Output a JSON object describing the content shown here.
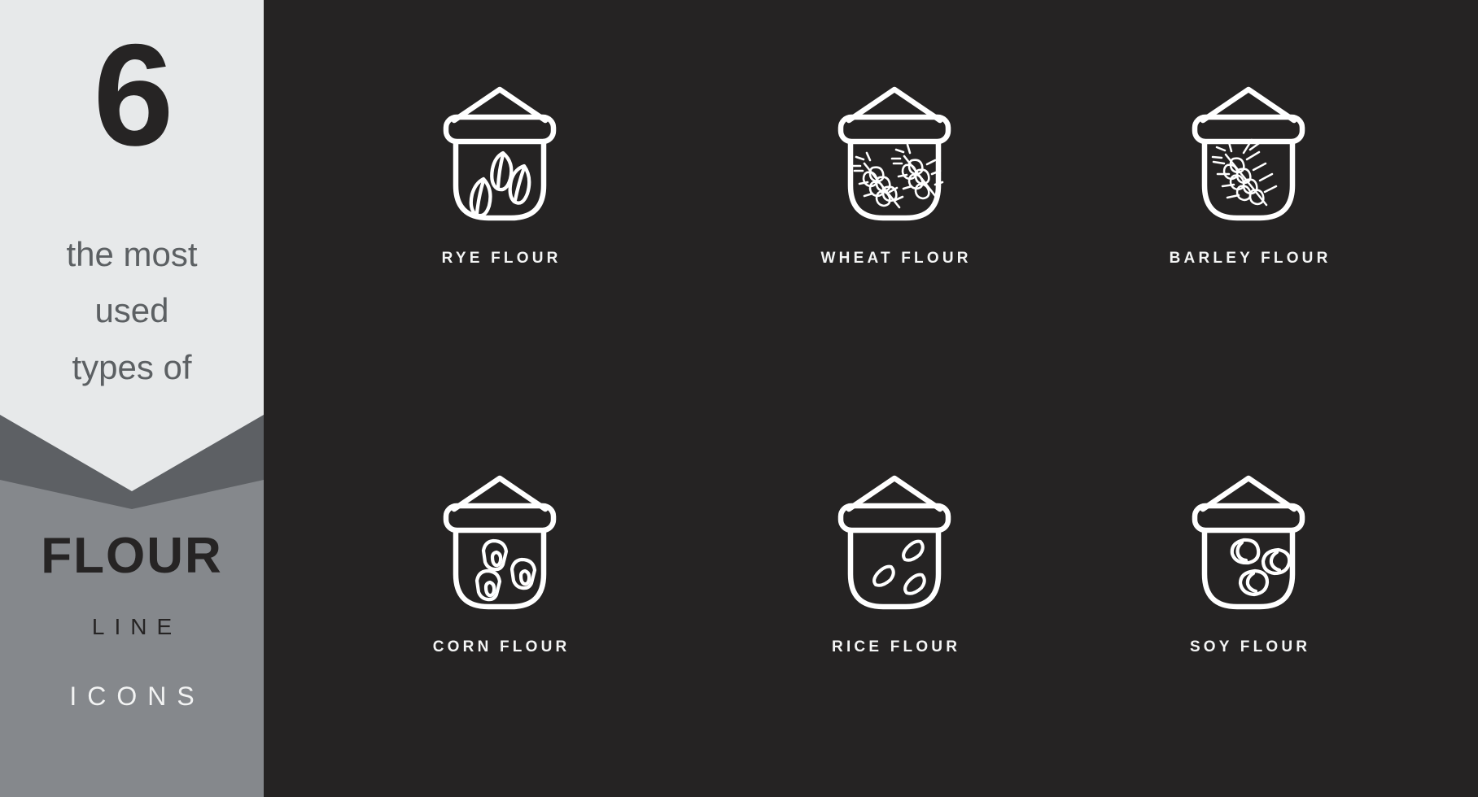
{
  "poster": {
    "background_color": "#252323",
    "panel_light_color": "#e7e9ea",
    "panel_mid_color": "#85888c",
    "panel_shadow_color": "#5d6064",
    "icon_stroke_color": "#ffffff",
    "label_color": "#f4f5f5"
  },
  "sidebar": {
    "count": "6",
    "subtitle_lines": [
      "the most",
      "used",
      "types of"
    ],
    "brand": "FLOUR",
    "kicker_line": "LINE",
    "kicker_icons": "ICONS"
  },
  "icons": [
    {
      "id": "rye-flour",
      "label": "RYE FLOUR",
      "icon_name": "flour-sack-rye-icon",
      "contents": "three elongated rye grains"
    },
    {
      "id": "wheat-flour",
      "label": "WHEAT FLOUR",
      "icon_name": "flour-sack-wheat-icon",
      "contents": "two wheat ears with awns"
    },
    {
      "id": "barley-flour",
      "label": "BARLEY FLOUR",
      "icon_name": "flour-sack-barley-icon",
      "contents": "single barley ear with long awns"
    },
    {
      "id": "corn-flour",
      "label": "CORN FLOUR",
      "icon_name": "flour-sack-corn-icon",
      "contents": "three corn kernels"
    },
    {
      "id": "rice-flour",
      "label": "RICE FLOUR",
      "icon_name": "flour-sack-rice-icon",
      "contents": "three rice grains"
    },
    {
      "id": "soy-flour",
      "label": "SOY FLOUR",
      "icon_name": "flour-sack-soy-icon",
      "contents": "three soy beans"
    }
  ]
}
